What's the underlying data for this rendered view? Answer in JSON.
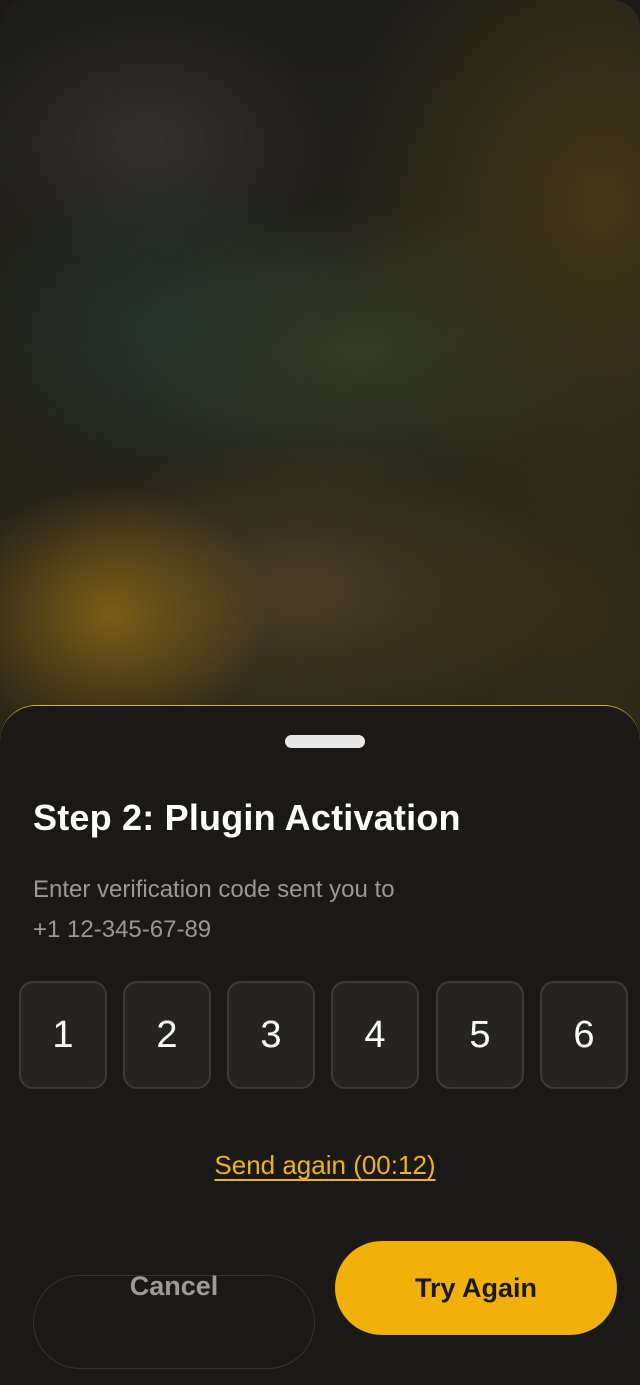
{
  "sheet": {
    "title": "Step 2: Plugin Activation",
    "subtitle_line1": "Enter verification code sent you to",
    "subtitle_line2": "+1 12-345-67-89"
  },
  "code": {
    "digits": [
      "1",
      "2",
      "3",
      "4",
      "5",
      "6"
    ]
  },
  "resend": {
    "label": "Send again (00:12)"
  },
  "actions": {
    "cancel_label": "Cancel",
    "try_again_label": "Try Again"
  },
  "colors": {
    "accent": "#f2b10a",
    "sheet_background": "#1a1918",
    "code_box_background": "#252423"
  }
}
